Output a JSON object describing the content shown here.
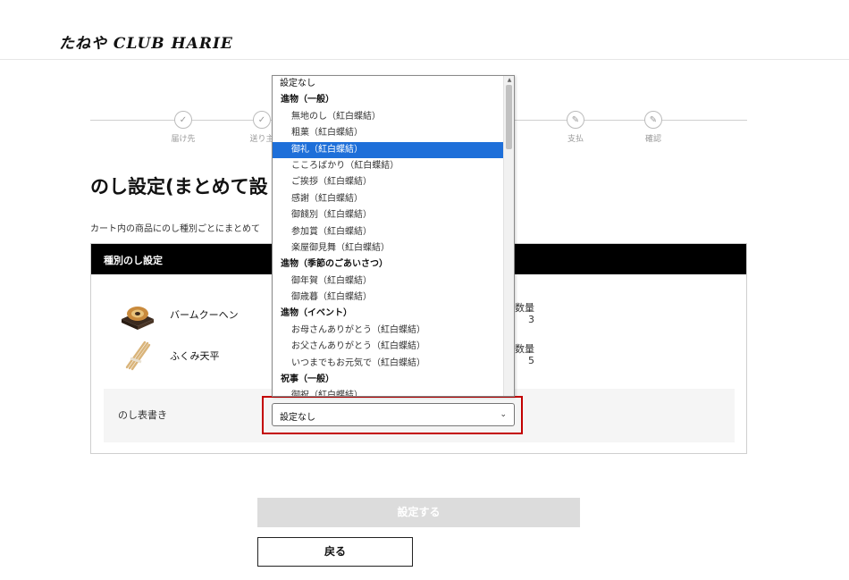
{
  "header": {
    "logo": "たねや CLUB HARIE"
  },
  "steps": [
    {
      "label": "届け先",
      "icon": "check-icon"
    },
    {
      "label": "送り主",
      "icon": "check-icon"
    },
    {
      "label": "",
      "icon": ""
    },
    {
      "label": "",
      "icon": ""
    },
    {
      "label": "",
      "icon": ""
    },
    {
      "label": "",
      "icon": ""
    },
    {
      "label": "支払",
      "icon": "pencil-icon"
    },
    {
      "label": "確認",
      "icon": "pencil-icon"
    }
  ],
  "page": {
    "title": "のし設定(まとめて設",
    "description": "カート内の商品にのし種別ごとにまとめて"
  },
  "card": {
    "header": "種別のし設定",
    "products": [
      {
        "name": "バームクーヘン",
        "qty_label": "数量",
        "qty": "3"
      },
      {
        "name": "ふくみ天平",
        "qty_label": "数量",
        "qty": "5"
      }
    ],
    "noshi_label": "のし表書き"
  },
  "select": {
    "value": "設定なし",
    "chevron": "⌄"
  },
  "dropdown": {
    "options": [
      {
        "text": "設定なし",
        "kind": "plain"
      },
      {
        "text": "進物（一般）",
        "kind": "group"
      },
      {
        "text": "無地のし（紅白蝶結）",
        "kind": "item"
      },
      {
        "text": "粗菓（紅白蝶結）",
        "kind": "item"
      },
      {
        "text": "御礼（紅白蝶結）",
        "kind": "item",
        "selected": true
      },
      {
        "text": "こころばかり（紅白蝶結）",
        "kind": "item"
      },
      {
        "text": "ご挨拶（紅白蝶結）",
        "kind": "item"
      },
      {
        "text": "感謝（紅白蝶結）",
        "kind": "item"
      },
      {
        "text": "御餞別（紅白蝶結）",
        "kind": "item"
      },
      {
        "text": "参加賞（紅白蝶結）",
        "kind": "item"
      },
      {
        "text": "楽屋御見舞（紅白蝶結）",
        "kind": "item"
      },
      {
        "text": "進物（季節のごあいさつ）",
        "kind": "group"
      },
      {
        "text": "御年賀（紅白蝶結）",
        "kind": "item"
      },
      {
        "text": "御歳暮（紅白蝶結）",
        "kind": "item"
      },
      {
        "text": "進物（イベント）",
        "kind": "group"
      },
      {
        "text": "お母さんありがとう（紅白蝶結）",
        "kind": "item"
      },
      {
        "text": "お父さんありがとう（紅白蝶結）",
        "kind": "item"
      },
      {
        "text": "いつまでもお元気で（紅白蝶結）",
        "kind": "item"
      },
      {
        "text": "祝事（一般）",
        "kind": "group"
      },
      {
        "text": "御祝（紅白蝶結）",
        "kind": "item"
      }
    ]
  },
  "buttons": {
    "submit": "設定する",
    "back": "戻る"
  },
  "colors": {
    "selected_option": "#1e6fd9",
    "highlight": "#c30000",
    "header_bar": "#000000"
  }
}
